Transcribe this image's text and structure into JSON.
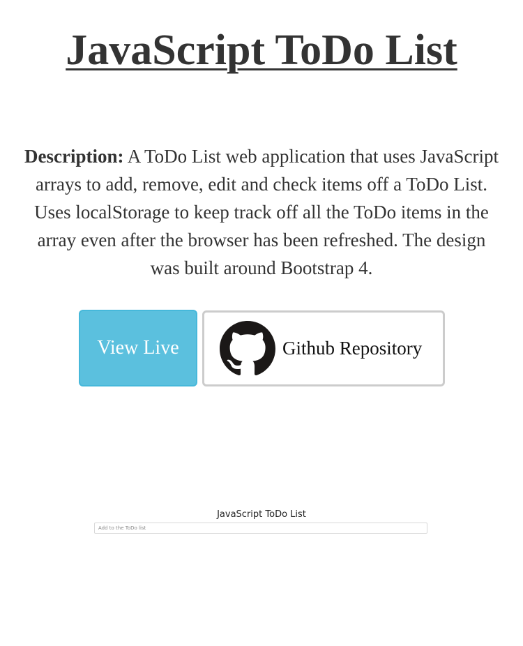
{
  "page": {
    "title": "JavaScript ToDo List",
    "description_label": "Description:",
    "description_text": " A ToDo List web application that uses JavaScript arrays to add, remove, edit and check items off a ToDo List. Uses localStorage to keep track off all the ToDo items in the array even after the browser has been refreshed. The design was built around Bootstrap 4."
  },
  "buttons": {
    "view_live": "View Live",
    "github": "Github Repository",
    "github_icon": "github-octocat-icon"
  },
  "preview": {
    "title": "JavaScript ToDo List",
    "input_placeholder": "Add to the ToDo list"
  },
  "colors": {
    "view_live_bg": "#5bc0de",
    "text": "#333333",
    "github_border": "#cccccc"
  }
}
